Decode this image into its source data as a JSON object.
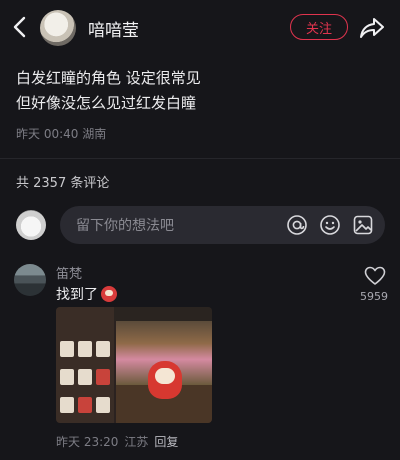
{
  "header": {
    "username": "喑喑莹",
    "follow_label": "关注"
  },
  "post": {
    "line1": "白发红瞳的角色 设定很常见",
    "line2": "但好像没怎么见过红发白瞳",
    "time": "昨天 00:40",
    "location": "湖南"
  },
  "comments_count_text": "共 2357 条评论",
  "comment_box": {
    "placeholder": "留下你的想法吧"
  },
  "comment": {
    "author": "笛梵",
    "text": "找到了",
    "likes": "5959",
    "time": "昨天 23:20",
    "location": "江苏",
    "reply_label": "回复"
  },
  "colors": {
    "background": "#16161a",
    "accent": "#e0344e",
    "input_bg": "#2a2a31",
    "muted_text": "#7d7d85"
  },
  "icons": [
    "back-icon",
    "share-icon",
    "at-icon",
    "emoji-icon",
    "image-icon",
    "heart-icon"
  ]
}
